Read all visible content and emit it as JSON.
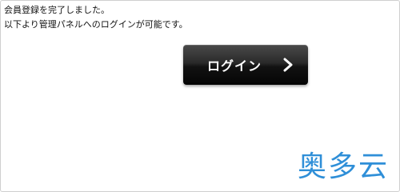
{
  "message": {
    "line1": "会員登録を完了しました。",
    "line2": "以下より管理パネルへのログインが可能です。"
  },
  "login_button": {
    "label": "ログイン",
    "icon": "chevron-right-icon"
  },
  "watermark": {
    "text": "奥多云"
  },
  "colors": {
    "button_bg": "#1a1a1a",
    "button_text": "#ffffff",
    "watermark": "#2f8fd8"
  }
}
